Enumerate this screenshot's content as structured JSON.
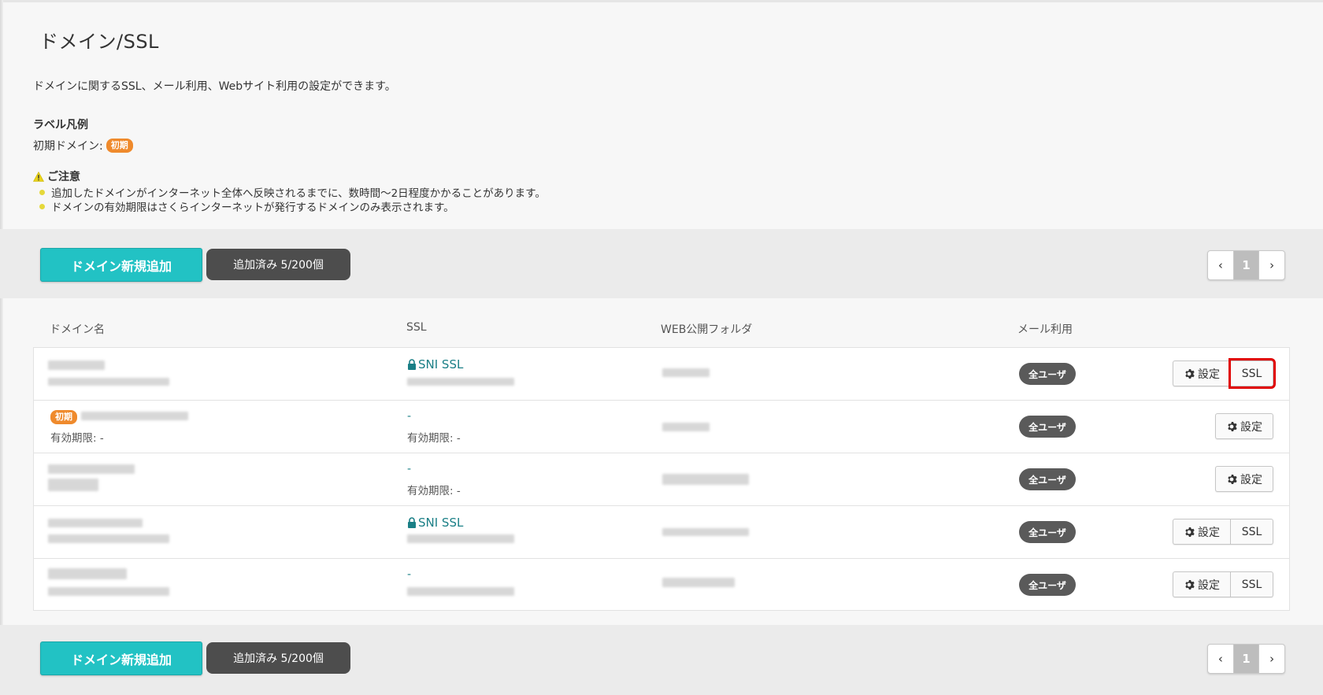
{
  "page": {
    "title": "ドメイン/SSL",
    "description": "ドメインに関するSSL、メール利用、Webサイト利用の設定ができます。"
  },
  "legend": {
    "heading": "ラベル凡例",
    "initial_domain_label": "初期ドメイン:",
    "initial_tag": "初期"
  },
  "notice": {
    "heading": "ご注意",
    "items": [
      "追加したドメインがインターネット全体へ反映されるまでに、数時間〜2日程度かかることがあります。",
      "ドメインの有効期限はさくらインターネットが発行するドメインのみ表示されます。"
    ]
  },
  "toolbar": {
    "add_button": "ドメイン新規追加",
    "count_badge": "追加済み 5/200個",
    "pager": {
      "prev": "‹",
      "current": "1",
      "next": "›"
    }
  },
  "table": {
    "headers": {
      "domain": "ドメイン名",
      "ssl": "SSL",
      "web_folder": "WEB公開フォルダ",
      "mail": "メール利用"
    },
    "rows": [
      {
        "ssl": "SNI SSL",
        "mail": "全ユーザ",
        "settings": "設定",
        "ssl_button": "SSL"
      },
      {
        "tag": "初期",
        "expiry": "有効期限: -",
        "ssl": "-",
        "ssl_expiry": "有効期限: -",
        "mail": "全ユーザ",
        "settings": "設定"
      },
      {
        "ssl": "-",
        "ssl_expiry": "有効期限: -",
        "mail": "全ユーザ",
        "settings": "設定"
      },
      {
        "ssl": "SNI SSL",
        "mail": "全ユーザ",
        "settings": "設定",
        "ssl_button": "SSL"
      },
      {
        "ssl": "-",
        "mail": "全ユーザ",
        "settings": "設定",
        "ssl_button": "SSL"
      }
    ]
  },
  "colors": {
    "accent": "#22c2c4",
    "tag_initial": "#ef8a2c",
    "ssl_link": "#1a7f86",
    "highlight": "#e00000"
  }
}
